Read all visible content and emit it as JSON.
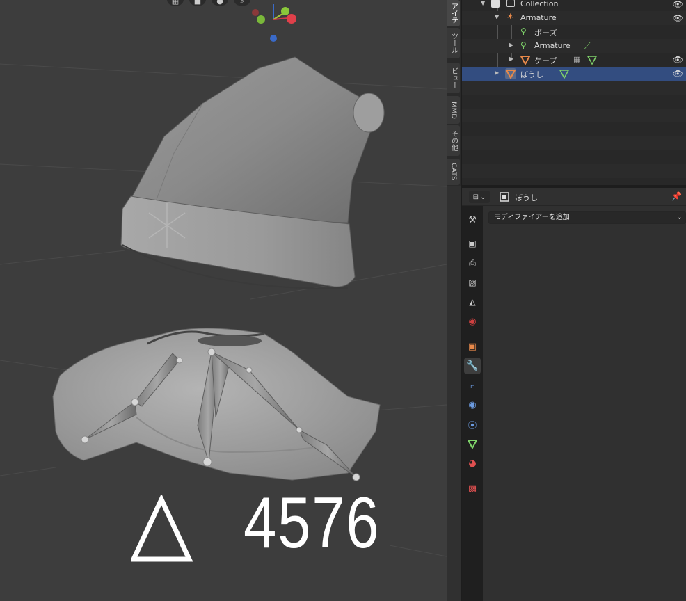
{
  "viewport": {
    "triangle_count": "4576",
    "nav_icons": [
      "grid-icon",
      "camera-icon",
      "hand-icon",
      "zoom-icon"
    ],
    "gizmo_axis_y": "Y",
    "gizmo_axis_x": "X"
  },
  "sidebar_tabs": [
    "アイテ",
    "ツール",
    "ビュー",
    "MMD",
    "その他",
    "CATS"
  ],
  "outliner": {
    "rows": [
      {
        "label": "Collection",
        "icon": "collection-icon"
      },
      {
        "label": "Armature",
        "icon": "armature-icon"
      },
      {
        "label": "ポーズ",
        "icon": "pose-icon"
      },
      {
        "label": "Armature",
        "icon": "armature-data-icon"
      },
      {
        "label": "ケープ",
        "icon": "mesh-icon"
      },
      {
        "label": "ぼうし",
        "icon": "mesh-icon"
      }
    ]
  },
  "properties": {
    "object_name": "ぼうし",
    "add_modifier_label": "モディファイアーを追加"
  },
  "colors": {
    "selected_row": "#334d80",
    "armature": "#e8894a",
    "mesh_data": "#7fd36a",
    "wrench_active": "#6c9be0"
  }
}
